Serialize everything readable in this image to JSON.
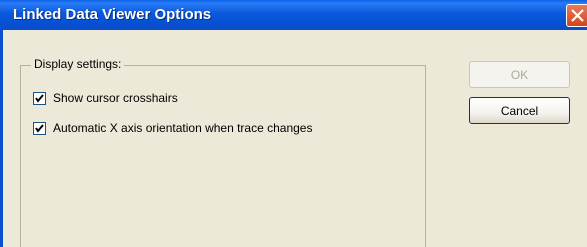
{
  "window": {
    "title": "Linked Data Viewer Options",
    "close_icon": "close-x-icon"
  },
  "display_settings": {
    "group_label": "Display settings:",
    "options": [
      {
        "label": "Show cursor crosshairs",
        "checked": true
      },
      {
        "label": "Automatic X axis orientation when trace changes",
        "checked": true
      }
    ]
  },
  "buttons": {
    "ok_label": "OK",
    "ok_enabled": false,
    "cancel_label": "Cancel"
  },
  "colors": {
    "titlebar": "#0a58dc",
    "close_button": "#d2441c",
    "dialog_background": "#ece9d8"
  }
}
